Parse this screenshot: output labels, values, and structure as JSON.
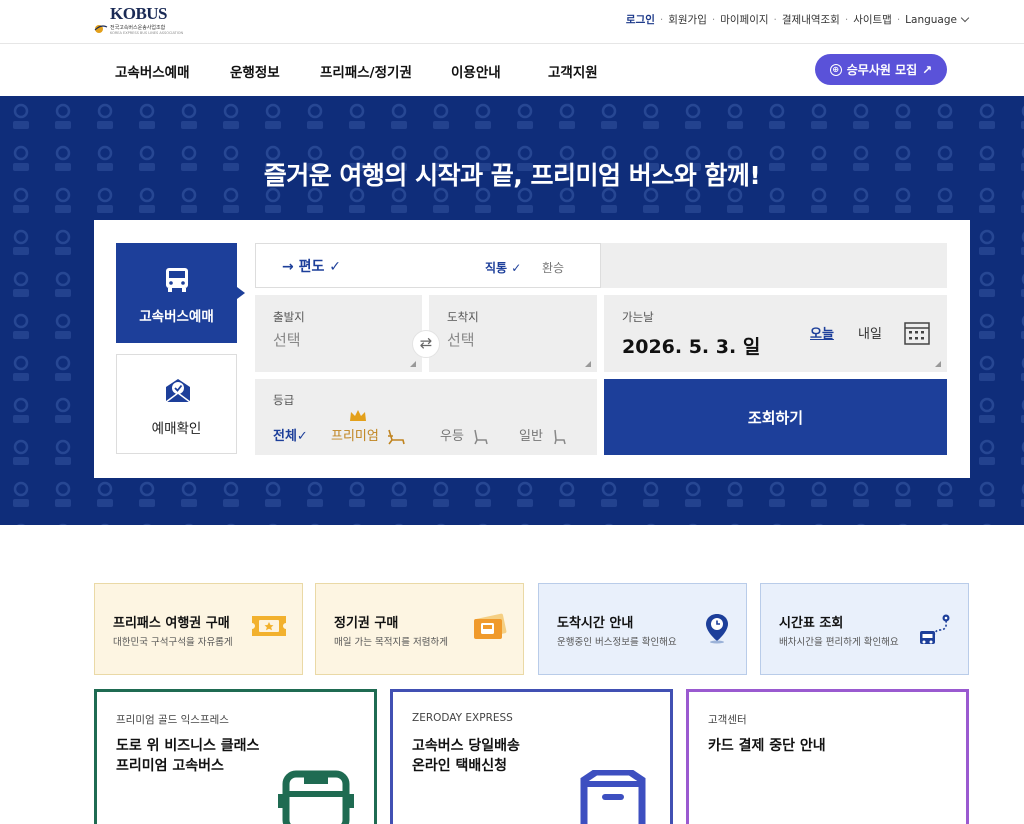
{
  "brand": {
    "logo_text": "KOBUS",
    "logo_subtitle": "전국고속버스운송사업조합",
    "logo_english": "KOREA EXPRESS BUS LINES ASSOCIATION"
  },
  "utility_nav": {
    "login": "로그인",
    "signup": "회원가입",
    "mypage": "마이페이지",
    "payment_history": "결제내역조회",
    "sitemap": "사이트맵",
    "language": "Language"
  },
  "main_nav": {
    "items": [
      "고속버스예매",
      "운행정보",
      "프리패스/정기권",
      "이용안내",
      "고객지원"
    ],
    "recruit_button": "승무사원 모집",
    "recruit_arrow": "↗"
  },
  "hero": {
    "title": "즐거운 여행의 시작과 끝, 프리미엄 버스와 함께!",
    "background_color": "#0f2d7a"
  },
  "booking": {
    "tabs": {
      "bus_reservation": "고속버스예매",
      "reservation_check": "예매확인"
    },
    "trip_type": {
      "one_way": "→ 편도 ✓",
      "direct": "직통 ✓",
      "transfer": "환승"
    },
    "departure": {
      "label": "출발지",
      "value": "선택"
    },
    "arrival": {
      "label": "도착지",
      "value": "선택"
    },
    "swap_icon": "⇄",
    "date": {
      "label": "가는날",
      "value": "2026. 5. 3. 일",
      "today": "오늘",
      "tomorrow": "내일"
    },
    "grade": {
      "label": "등급",
      "options": [
        "전체✓",
        "프리미엄",
        "우등",
        "일반"
      ],
      "selected": "전체"
    },
    "search_button": "조회하기"
  },
  "quick_tiles": [
    {
      "title": "프리패스 여행권 구매",
      "desc": "대한민국 구석구석을 자유롭게",
      "icon": "ticket-icon"
    },
    {
      "title": "정기권 구매",
      "desc": "매일 가는 목적지를 저렴하게",
      "icon": "pass-card-icon"
    },
    {
      "title": "도착시간 안내",
      "desc": "운행중인 버스정보를 확인해요",
      "icon": "location-clock-icon"
    },
    {
      "title": "시간표 조회",
      "desc": "배차시간을 편리하게 확인해요",
      "icon": "route-bus-icon"
    }
  ],
  "promos": [
    {
      "small": "프리미엄 골드 익스프레스",
      "line1": "도로 위 비즈니스 클래스",
      "line2": "프리미엄 고속버스",
      "color": "#1f6b52"
    },
    {
      "small": "ZERODAY EXPRESS",
      "line1": "고속버스 당일배송",
      "line2": "온라인 택배신청",
      "color": "#4150b3"
    },
    {
      "small": "고객센터",
      "line1": "카드 결제 중단 안내",
      "line2": "",
      "color": "#9a5ad0"
    }
  ],
  "colors": {
    "primary": "#1d3f9a",
    "recruit": "#5a52d9",
    "premium": "#c08420"
  }
}
